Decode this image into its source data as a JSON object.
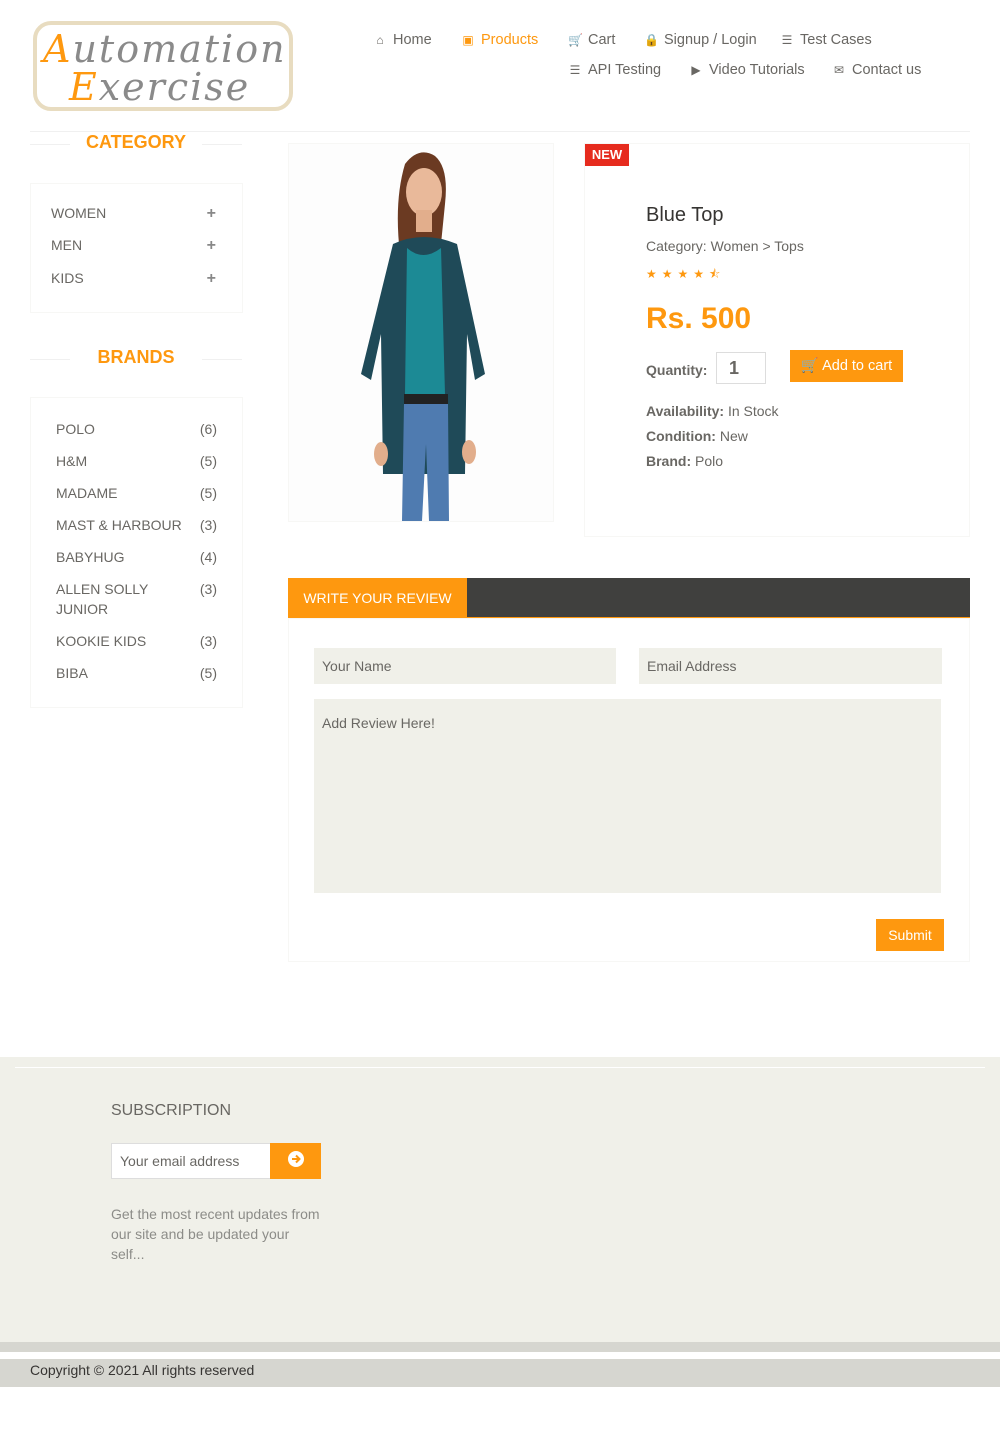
{
  "header": {
    "logo": {
      "line1_cap": "A",
      "line1_rest": "utomation",
      "line2_cap": "E",
      "line2_rest": "xercise"
    },
    "nav": [
      {
        "label": "Home",
        "icon": "home-icon"
      },
      {
        "label": "Products",
        "icon": "briefcase-icon",
        "active": true
      },
      {
        "label": "Cart",
        "icon": "cart-icon"
      },
      {
        "label": "Signup / Login",
        "icon": "lock-icon"
      },
      {
        "label": "Test Cases",
        "icon": "list-icon"
      },
      {
        "label": "API Testing",
        "icon": "list-icon"
      },
      {
        "label": "Video Tutorials",
        "icon": "youtube-play-icon"
      },
      {
        "label": "Contact us",
        "icon": "envelope-icon"
      }
    ]
  },
  "sidebar": {
    "category_title": "CATEGORY",
    "categories": [
      {
        "label": "WOMEN",
        "toggle": "+"
      },
      {
        "label": "MEN",
        "toggle": "+"
      },
      {
        "label": "KIDS",
        "toggle": "+"
      }
    ],
    "brands_title": "BRANDS",
    "brands": [
      {
        "name": "POLO",
        "count": "(6)"
      },
      {
        "name": "H&M",
        "count": "(5)"
      },
      {
        "name": "MADAME",
        "count": "(5)"
      },
      {
        "name": "MAST & HARBOUR",
        "count": "(3)"
      },
      {
        "name": "BABYHUG",
        "count": "(4)"
      },
      {
        "name": "ALLEN SOLLY JUNIOR",
        "count": "(3)"
      },
      {
        "name": "KOOKIE KIDS",
        "count": "(3)"
      },
      {
        "name": "BIBA",
        "count": "(5)"
      }
    ]
  },
  "product": {
    "badge": "NEW",
    "name": "Blue Top",
    "category": "Category: Women > Tops",
    "rating": 4.5,
    "stars": "★★★★⯪",
    "price": "Rs. 500",
    "quantity_label": "Quantity:",
    "quantity_value": "1",
    "add_to_cart": "Add to cart",
    "availability_label": "Availability:",
    "availability": "In Stock",
    "condition_label": "Condition:",
    "condition": "New",
    "brand_label": "Brand:",
    "brand": "Polo"
  },
  "review": {
    "tab": "WRITE YOUR REVIEW",
    "name_placeholder": "Your Name",
    "email_placeholder": "Email Address",
    "review_placeholder": "Add Review Here!",
    "submit": "Submit"
  },
  "footer": {
    "subscription_title": "SUBSCRIPTION",
    "email_placeholder": "Your email address",
    "subscribe_icon": "arrow-circle-right-icon",
    "subscription_text": "Get the most recent updates from our site and be updated your self...",
    "copyright": "Copyright © 2021 All rights reserved"
  },
  "colors": {
    "accent": "#fe980f",
    "badge": "#e62b1e",
    "tabbar": "#40403e",
    "footer_bg": "#f0f0e9"
  }
}
